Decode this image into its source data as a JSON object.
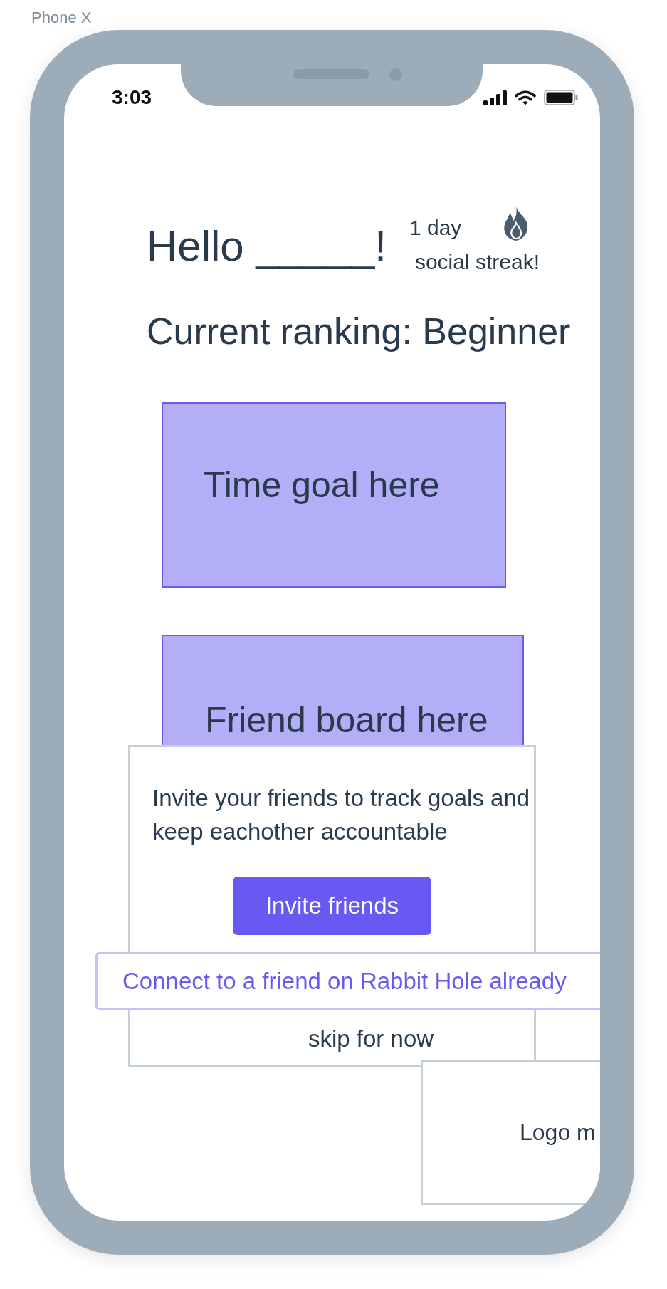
{
  "frame_label": "Phone X",
  "status_bar": {
    "time": "3:03"
  },
  "greeting": "Hello _____!",
  "streak": {
    "count": "1 day",
    "label": "social streak!"
  },
  "ranking": "Current ranking: Beginner",
  "cards": [
    {
      "label": "Time goal here"
    },
    {
      "label": "Friend board here"
    }
  ],
  "invite_dialog": {
    "message": "Invite your friends to track goals and keep eachother accountable",
    "primary_button": "Invite friends",
    "skip_link": "skip for now"
  },
  "connect_link": "Connect to a friend on Rabbit Hole already",
  "logo_card": {
    "label": "Logo m"
  }
}
